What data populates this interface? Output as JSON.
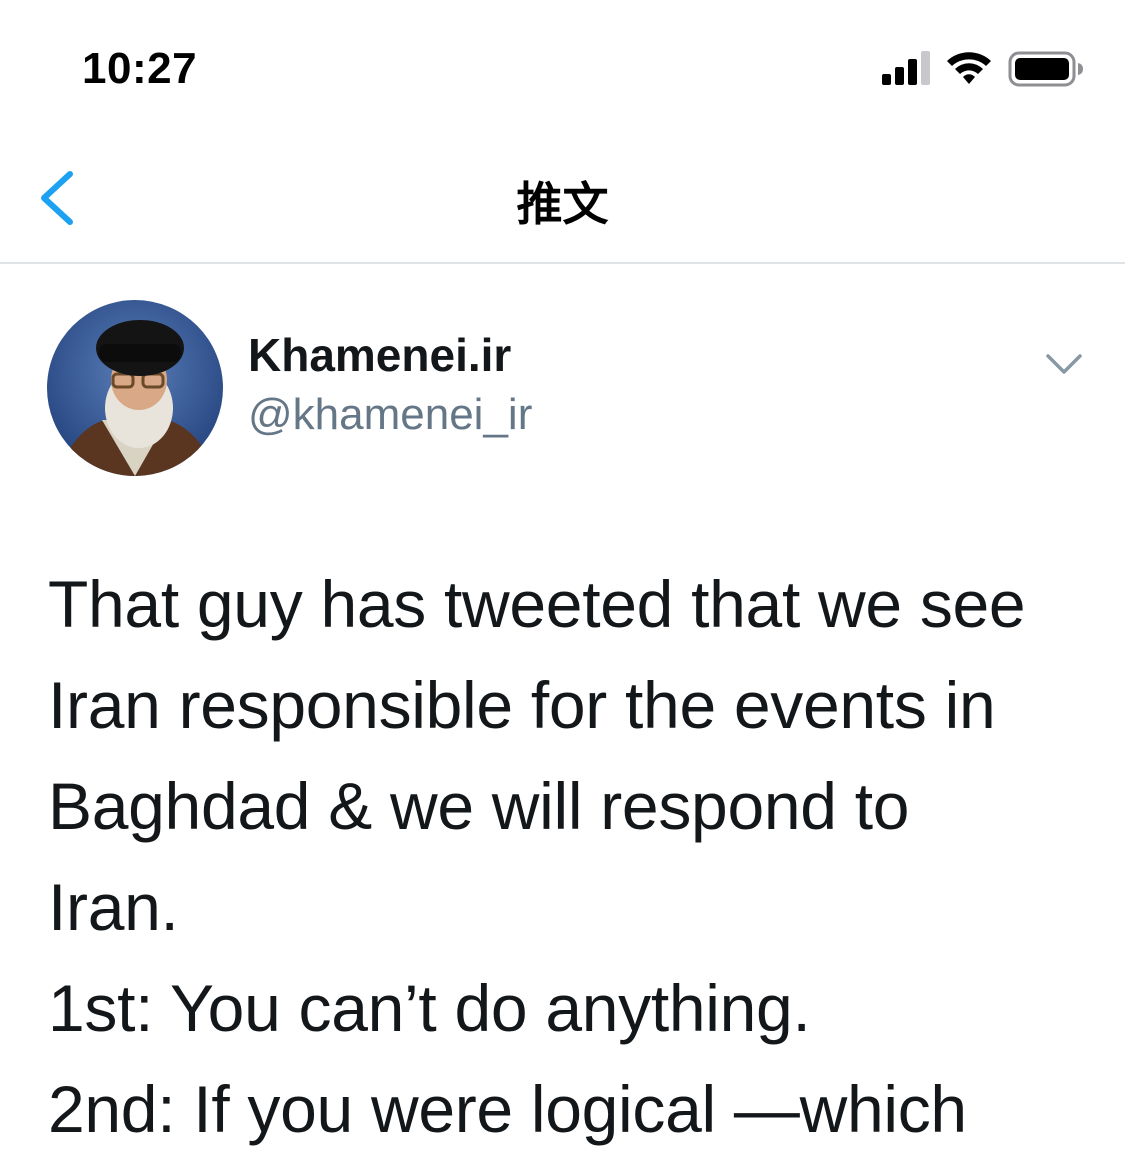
{
  "status_bar": {
    "time": "10:27",
    "icons": [
      "cellular-signal-icon",
      "wifi-icon",
      "battery-icon"
    ]
  },
  "nav": {
    "back_icon": "chevron-left-icon",
    "title": "推文"
  },
  "tweet": {
    "author": {
      "display_name": "Khamenei.ir",
      "handle": "@khamenei_ir"
    },
    "menu_icon": "chevron-down-icon",
    "text_lines": [
      "That guy has tweeted that we see",
      "Iran responsible for the events in",
      "Baghdad & we will respond to",
      "Iran.",
      "1st: You can’t do anything.",
      "2nd: If you were logical —which"
    ]
  },
  "colors": {
    "accent": "#1da1f2",
    "text_primary": "#14171a",
    "text_secondary": "#657786",
    "divider": "#dfe3e6"
  }
}
